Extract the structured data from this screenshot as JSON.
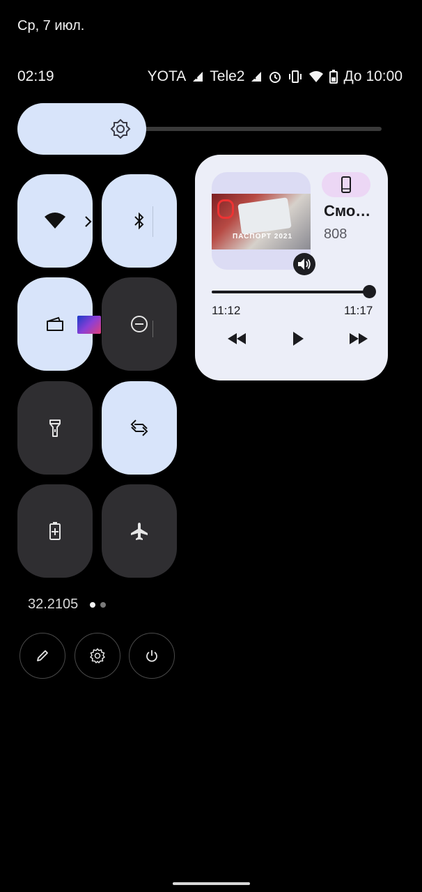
{
  "header": {
    "date": "Ср, 7 июл."
  },
  "status_bar": {
    "time": "02:19",
    "carrier1": "YOTA",
    "carrier2": "Tele2",
    "battery_text": "До 10:00"
  },
  "brightness": {
    "level": 0.3
  },
  "tiles": [
    {
      "name": "wifi",
      "icon": "wifi-icon",
      "state": "on",
      "has_chevron": true
    },
    {
      "name": "bluetooth",
      "icon": "bluetooth-icon",
      "state": "on"
    },
    {
      "name": "wallet",
      "icon": "wallet-icon",
      "state": "on"
    },
    {
      "name": "do-not-disturb",
      "icon": "dnd-icon",
      "state": "off"
    },
    {
      "name": "flashlight",
      "icon": "flashlight-icon",
      "state": "off"
    },
    {
      "name": "auto-rotate",
      "icon": "rotate-icon",
      "state": "on"
    },
    {
      "name": "battery-saver",
      "icon": "battery-saver-icon",
      "state": "off"
    },
    {
      "name": "airplane-mode",
      "icon": "airplane-icon",
      "state": "off"
    }
  ],
  "media": {
    "title": "Смо…",
    "artist": "808",
    "album_art_caption": "ПАСПОРТ 2021",
    "elapsed": "11:12",
    "total": "11:17",
    "progress": 0.99
  },
  "footer": {
    "build": "32.2105",
    "page_dots": 2,
    "active_dot": 0
  },
  "colors": {
    "tile_on": "#d8e4fa",
    "tile_off": "#2f2e31",
    "media_bg": "#eceef8",
    "device_chip": "#ecd7f5"
  }
}
